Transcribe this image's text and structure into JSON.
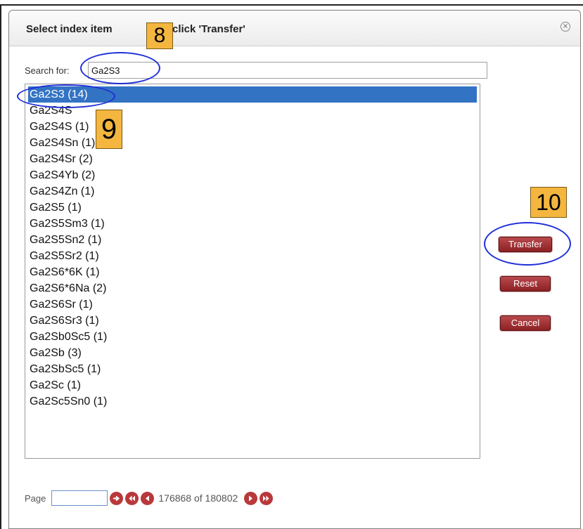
{
  "dialog": {
    "title_left": "Select index item",
    "title_right": "click 'Transfer'",
    "close_glyph": "×"
  },
  "search": {
    "label": "Search for:",
    "value": "Ga2S3"
  },
  "list": {
    "selected_index": 0,
    "items": [
      "Ga2S3 (14)",
      "Ga2S4S",
      "Ga2S4S (1)",
      "Ga2S4Sn (1)",
      "Ga2S4Sr (2)",
      "Ga2S4Yb (2)",
      "Ga2S4Zn (1)",
      "Ga2S5 (1)",
      "Ga2S5Sm3 (1)",
      "Ga2S5Sn2 (1)",
      "Ga2S5Sr2 (1)",
      "Ga2S6*6K (1)",
      "Ga2S6*6Na (2)",
      "Ga2S6Sr (1)",
      "Ga2S6Sr3 (1)",
      "Ga2Sb0Sc5 (1)",
      "Ga2Sb (3)",
      "Ga2SbSc5 (1)",
      "Ga2Sc (1)",
      "Ga2Sc5Sn0 (1)"
    ]
  },
  "buttons": {
    "transfer": "Transfer",
    "reset": "Reset",
    "cancel": "Cancel"
  },
  "pager": {
    "label": "Page",
    "input_value": "",
    "status": "176868 of 180802"
  },
  "annotations": {
    "step_8": "8",
    "step_9": "9",
    "step_10": "10",
    "highlight_color": "#1f2fd8",
    "callout_color": "#f4b63f"
  },
  "colors": {
    "selection": "#3373c4",
    "button": "#9a2b2e"
  }
}
